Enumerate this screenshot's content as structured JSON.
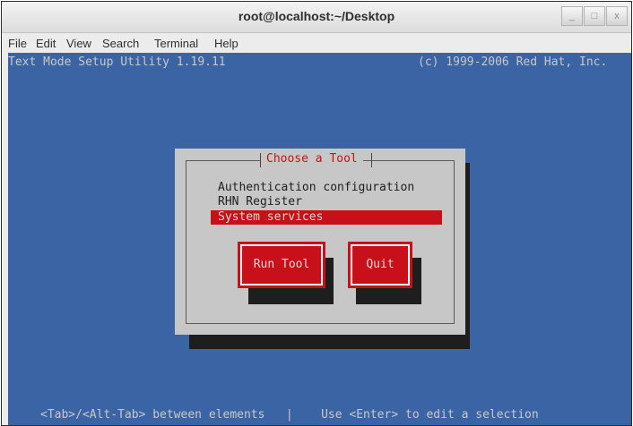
{
  "window": {
    "title": "root@localhost:~/Desktop",
    "controls": {
      "minimize": "_",
      "maximize": "□",
      "close": "x"
    }
  },
  "menubar": [
    "File",
    "Edit",
    "View",
    "Search",
    "Terminal",
    "Help"
  ],
  "terminal": {
    "header_left": "Text Mode Setup Utility 1.19.11",
    "header_right": "(c) 1999-2006 Red Hat, Inc.",
    "background_color": "#3a64a4",
    "dialog": {
      "title": "Choose a Tool",
      "options": [
        "Authentication configuration",
        "RHN Register",
        "System services"
      ],
      "selected_option": "System services",
      "buttons": {
        "run_tool": "Run Tool",
        "quit": "Quit"
      }
    },
    "footer": "<Tab>/<Alt-Tab> between elements   |    Use <Enter> to edit a selection"
  },
  "colors": {
    "accent_red": "#c8101a",
    "dialog_gray": "#c7c7c7",
    "shadow": "#1e1e1e"
  }
}
